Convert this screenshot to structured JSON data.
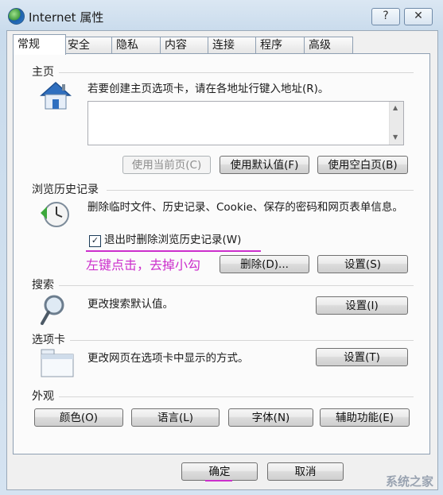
{
  "window": {
    "title": "Internet 属性",
    "help_button": "?",
    "close_button": "✕"
  },
  "tabs": [
    "常规",
    "安全",
    "隐私",
    "内容",
    "连接",
    "程序",
    "高级"
  ],
  "home_page": {
    "label": "主页",
    "description": "若要创建主页选项卡，请在各地址行键入地址(R)。",
    "address_value": "",
    "buttons": {
      "use_current": "使用当前页(C)",
      "use_default": "使用默认值(F)",
      "use_blank": "使用空白页(B)"
    }
  },
  "history": {
    "label": "浏览历史记录",
    "description": "删除临时文件、历史记录、Cookie、保存的密码和网页表单信息。",
    "checkbox_label": "退出时删除浏览历史记录(W)",
    "checkbox_checked": true,
    "buttons": {
      "delete": "删除(D)...",
      "settings": "设置(S)"
    }
  },
  "annotation": {
    "text": "左键点击，去掉小勾"
  },
  "search": {
    "label": "搜索",
    "description": "更改搜索默认值。",
    "settings": "设置(I)"
  },
  "tabs_section": {
    "label": "选项卡",
    "description": "更改网页在选项卡中显示的方式。",
    "settings": "设置(T)"
  },
  "appearance": {
    "label": "外观",
    "buttons": {
      "colors": "颜色(O)",
      "languages": "语言(L)",
      "fonts": "字体(N)",
      "accessibility": "辅助功能(E)"
    }
  },
  "footer": {
    "ok": "确定",
    "cancel": "取消"
  },
  "watermark": {
    "text": "系统之家"
  },
  "colors": {
    "annotation": "#cc2fcc",
    "title_bar": "#c9dbec"
  }
}
